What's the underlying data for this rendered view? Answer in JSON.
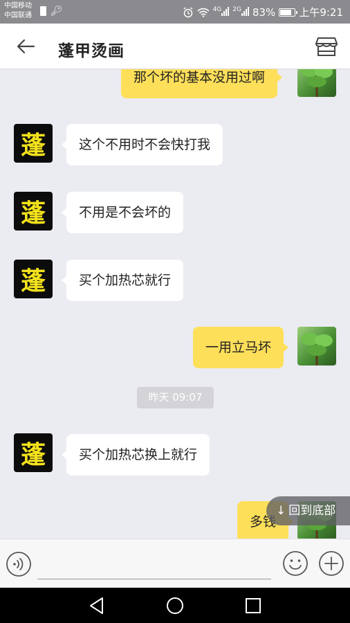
{
  "status_bar": {
    "carrier1": "中国移动",
    "carrier2": "中国联通",
    "net1": "4G",
    "net2": "2G",
    "battery": "83%",
    "battery_level": 0.83,
    "time": "上午9:21"
  },
  "header": {
    "title": "蓬甲烫画"
  },
  "avatars": {
    "contact_char": "蓬"
  },
  "messages": [
    {
      "side": "out",
      "text": "那个坏的基本没用过啊"
    },
    {
      "side": "in",
      "text": "这个不用时不会快打我"
    },
    {
      "side": "in",
      "text": "不用是不会坏的"
    },
    {
      "side": "in",
      "text": "买个加热芯就行"
    },
    {
      "side": "out",
      "text": "一用立马坏"
    },
    {
      "side": "in",
      "text": "买个加热芯换上就行"
    },
    {
      "side": "out",
      "text": "多钱"
    }
  ],
  "timestamp": "昨天 09:07",
  "scroll_button": {
    "arrow": "↓",
    "label": "回到底部"
  },
  "input": {
    "value": "",
    "placeholder": ""
  },
  "icons": {
    "back": "back-arrow-icon",
    "store": "store-icon",
    "voice": "voice-icon",
    "emoji": "emoji-icon",
    "plus": "plus-icon"
  },
  "colors": {
    "outgoing_bubble": "#fedf5a",
    "incoming_bubble": "#ffffff",
    "chat_background": "#ebebf2",
    "avatar_text": "#f4e21c"
  }
}
